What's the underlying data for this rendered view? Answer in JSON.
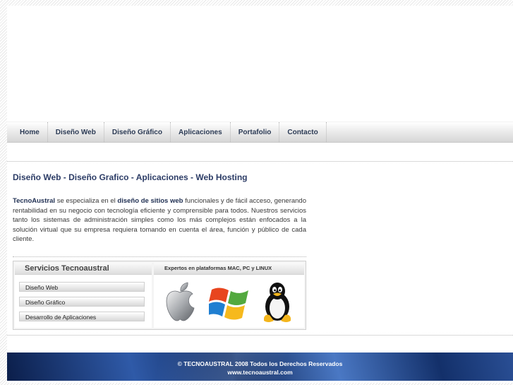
{
  "nav": {
    "items": [
      {
        "label": "Home"
      },
      {
        "label": "Diseño Web"
      },
      {
        "label": "Diseño Gráfico"
      },
      {
        "label": "Aplicaciones"
      },
      {
        "label": "Portafolio"
      },
      {
        "label": "Contacto"
      }
    ]
  },
  "main": {
    "title": "Diseño Web - Diseño Grafico - Aplicaciones - Web Hosting",
    "intro": {
      "brand": "TecnoAustral",
      "part1": " se especializa en el ",
      "highlight": "diseño de sitios web",
      "part2": " funcionales y de fácil acceso, generando rentabilidad en su negocio con tecnología eficiente y comprensible para todos. Nuestros servicios tanto los sistemas de administración simples como los más complejos están enfocados a la solución virtual que su empresa requiera tomando en cuenta el área, función y público de cada cliente."
    }
  },
  "services": {
    "title": "Servicios Tecnoaustral",
    "buttons": [
      {
        "label": "Diseño Web"
      },
      {
        "label": "Diseño Gráfico"
      },
      {
        "label": "Desarrollo de Aplicaciones"
      }
    ],
    "platforms_title": "Expertos en plataformas MAC, PC y LINUX",
    "logos": [
      "apple-logo-icon",
      "windows-logo-icon",
      "linux-penguin-icon"
    ]
  },
  "footer": {
    "copyright": "© TECNOAUSTRAL 2008 Todos los Derechos Reservados",
    "url": "www.tecnoaustral.com"
  },
  "colors": {
    "nav_text": "#2c3b55",
    "title": "#2c3c66",
    "footer_bg": "#1d3c7f"
  }
}
